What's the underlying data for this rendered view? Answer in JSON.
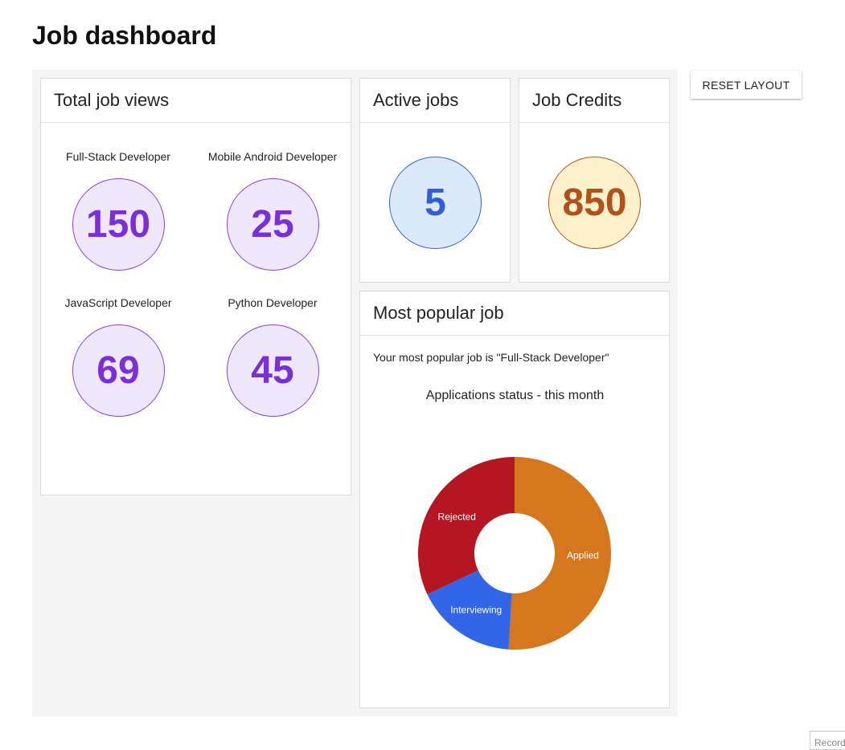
{
  "page": {
    "title": "Job dashboard"
  },
  "toolbar": {
    "reset_label": "RESET LAYOUT"
  },
  "total_job_views": {
    "title": "Total job views",
    "items": [
      {
        "label": "Full-Stack Developer",
        "value": "150"
      },
      {
        "label": "Mobile Android Developer",
        "value": "25"
      },
      {
        "label": "JavaScript Developer",
        "value": "69"
      },
      {
        "label": "Python Developer",
        "value": "45"
      }
    ]
  },
  "active_jobs": {
    "title": "Active jobs",
    "value": "5"
  },
  "job_credits": {
    "title": "Job Credits",
    "value": "850"
  },
  "most_popular": {
    "title": "Most popular job",
    "text": "Your most popular job is \"Full-Stack Developer\"",
    "chart_title": "Applications status - this month"
  },
  "colors": {
    "purple_accent": "#7a30d8",
    "blue_accent": "#2f5fd9",
    "orange_accent": "#b0521c",
    "applied": "#d6761d",
    "interviewing": "#3366e6",
    "rejected": "#b41722"
  },
  "chart_data": {
    "type": "pie",
    "title": "Applications status - this month",
    "categories": [
      "Applied",
      "Interviewing",
      "Rejected"
    ],
    "values": [
      51,
      17,
      32
    ],
    "colors": [
      "#d6761d",
      "#3366e6",
      "#b41722"
    ],
    "donut": true
  },
  "footer": {
    "record_label": "Record"
  }
}
